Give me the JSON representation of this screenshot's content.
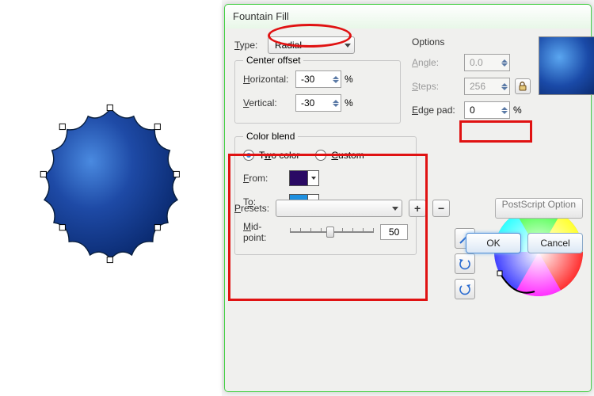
{
  "dialog": {
    "title": "Fountain Fill",
    "type_label": "Type:",
    "type_value": "Radial",
    "center_offset_legend": "Center offset",
    "horizontal_label": "Horizontal:",
    "horizontal_value": "-30",
    "vertical_label": "Vertical:",
    "vertical_value": "-30",
    "percent": "%",
    "options_label": "Options",
    "angle_label": "Angle:",
    "angle_value": "0.0",
    "steps_label": "Steps:",
    "steps_value": "256",
    "edge_pad_label": "Edge pad:",
    "edge_pad_value": "0",
    "color_blend_legend": "Color blend",
    "radio_two_color": "Two color",
    "radio_custom": "Custom",
    "from_label": "From:",
    "to_label": "To:",
    "midpoint_label": "Mid-point:",
    "midpoint_value": "50",
    "presets_label": "Presets:",
    "presets_value": "",
    "postscript_label": "PostScript Option",
    "ok_label": "OK",
    "cancel_label": "Cancel",
    "colors": {
      "from": "#2a0a64",
      "to": "#1e90e0"
    }
  },
  "plus": "+",
  "minus": "−"
}
